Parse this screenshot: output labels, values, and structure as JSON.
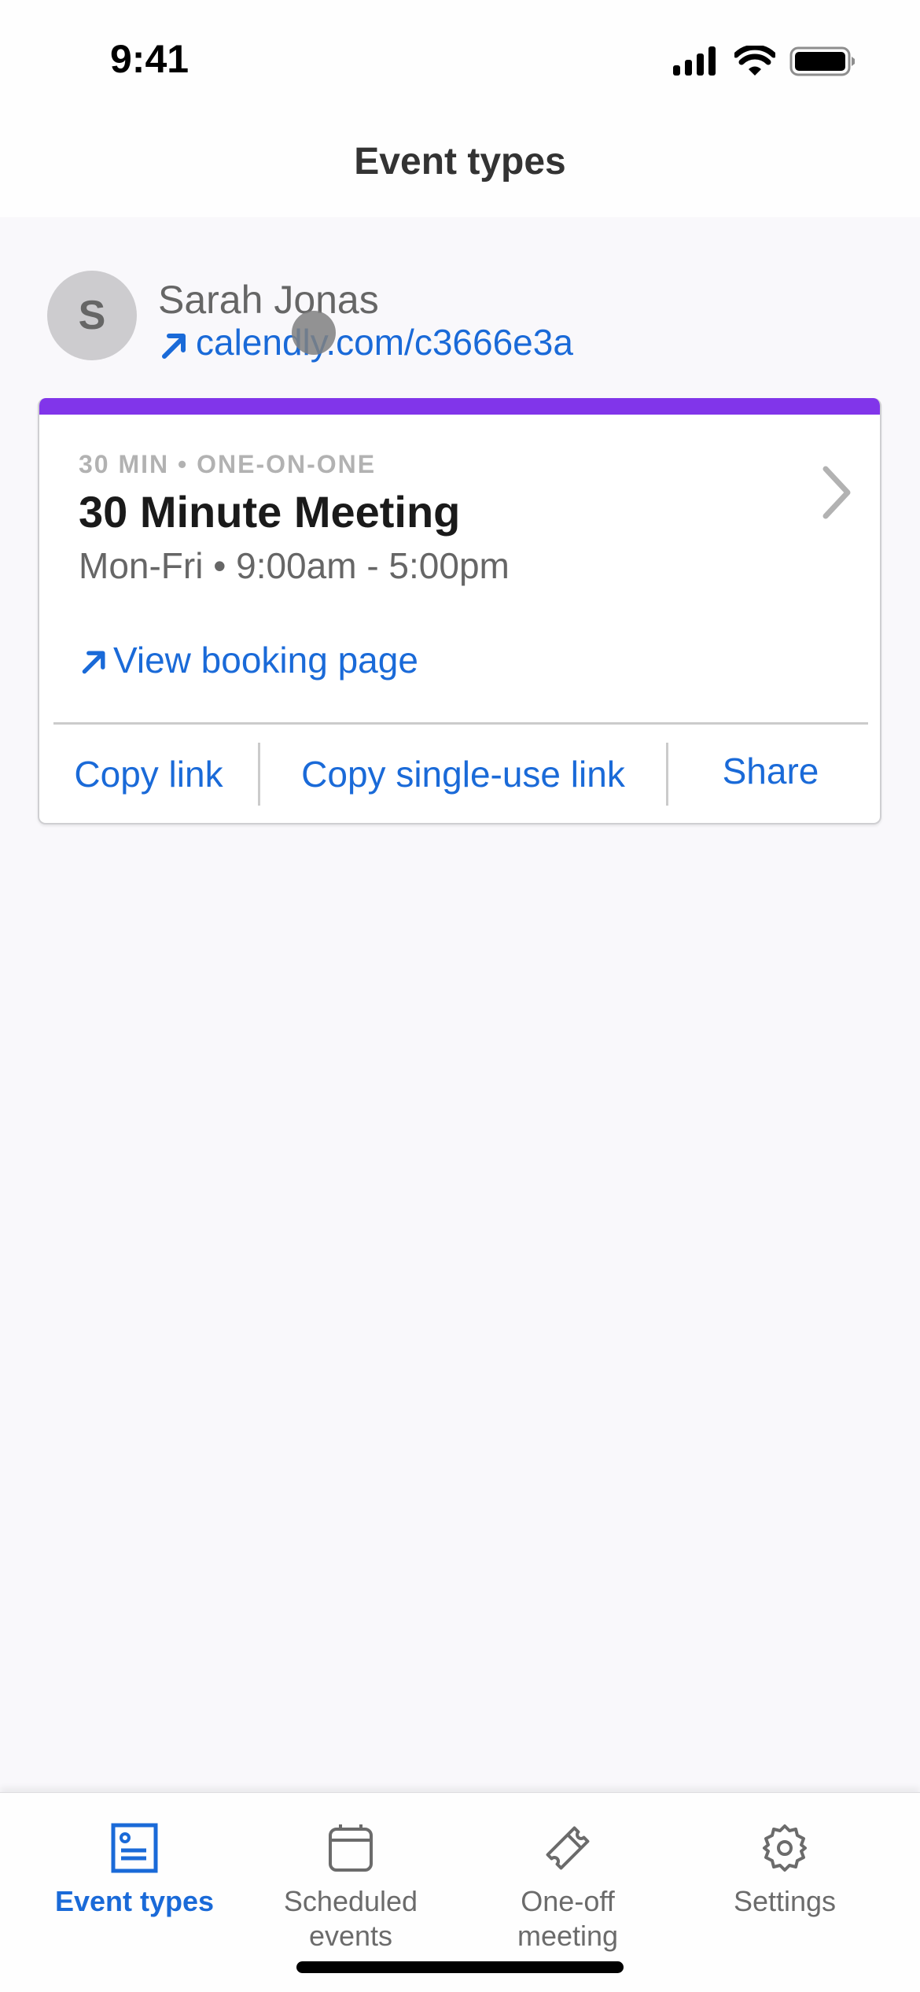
{
  "status_bar": {
    "time": "9:41",
    "icons": [
      "cellular-signal-icon",
      "wifi-icon",
      "battery-icon"
    ]
  },
  "header": {
    "title": "Event types"
  },
  "profile": {
    "avatar_initial": "S",
    "name": "Sarah Jonas",
    "link": "calendly.com/c3666e3a",
    "link_icon": "external-link-arrow-icon"
  },
  "event_card": {
    "accent_color": "#8135ea",
    "meta": "30 MIN • ONE-ON-ONE",
    "title": "30 Minute Meeting",
    "schedule": "Mon-Fri • 9:00am - 5:00pm",
    "view_booking_label": "View booking page",
    "actions": {
      "copy_link": "Copy link",
      "copy_single_use_link": "Copy single-use link",
      "share": "Share"
    }
  },
  "tab_bar": {
    "active_color": "#1a6ad8",
    "inactive_color": "#6b6b6b",
    "tabs": [
      {
        "label": "Event types",
        "icon": "event-types-icon",
        "active": true
      },
      {
        "label": "Scheduled\nevents",
        "icon": "calendar-icon",
        "active": false
      },
      {
        "label": "One-off\nmeeting",
        "icon": "ticket-icon",
        "active": false
      },
      {
        "label": "Settings",
        "icon": "gear-icon",
        "active": false
      }
    ]
  }
}
